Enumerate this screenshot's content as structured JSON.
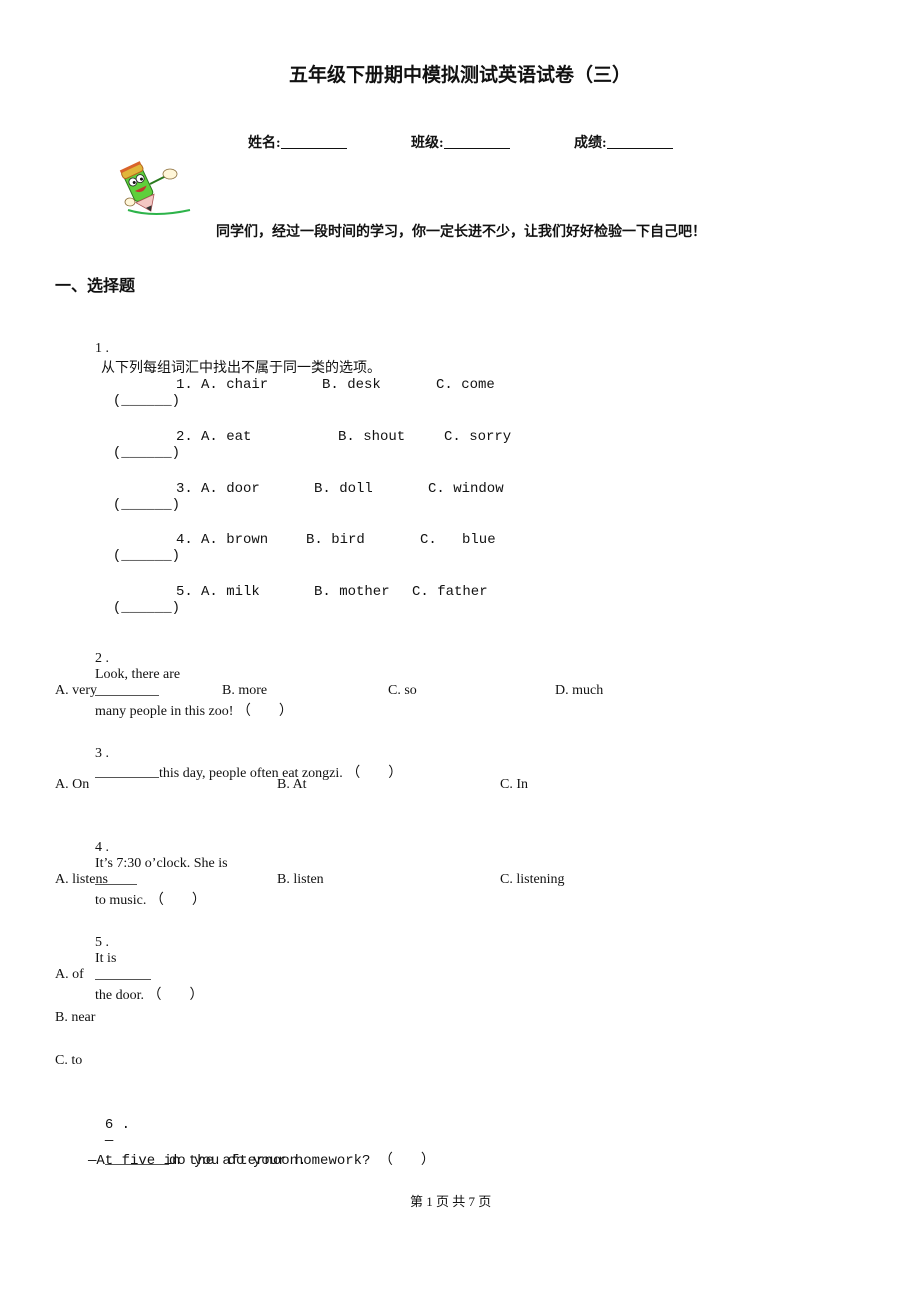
{
  "header": {
    "title": "五年级下册期中模拟测试英语试卷（三）",
    "fields": [
      {
        "label": "姓名:",
        "value": ""
      },
      {
        "label": "班级:",
        "value": ""
      },
      {
        "label": "成绩:",
        "value": ""
      }
    ],
    "mascot_icon": "pencil-mascot-icon",
    "greeting": "同学们，经过一段时间的学习，你一定长进不少，让我们好好检验一下自己吧！"
  },
  "section": {
    "title": "一、选择题"
  },
  "q1": {
    "number": "1 .",
    "prompt": "从下列每组词汇中找出不属于同一类的选项。",
    "items": [
      {
        "paren": "(______)",
        "num": "1.",
        "a": "A. chair",
        "b": "B. desk",
        "c": "C. come"
      },
      {
        "paren": "(______)",
        "num": "2.",
        "a": "A. eat",
        "b": "B. shout",
        "c": "C. sorry"
      },
      {
        "paren": "(______)",
        "num": "3.",
        "a": "A. door",
        "b": "B. doll",
        "c": "C. window"
      },
      {
        "paren": "(______)",
        "num": "4.",
        "a": "A. brown",
        "b": "B. bird",
        "c": "C.   blue"
      },
      {
        "paren": "(______)",
        "num": "5.",
        "a": "A. milk",
        "b": "B. mother",
        "c": "C. father"
      }
    ]
  },
  "q2": {
    "number": "2 .",
    "before": "Look, there are",
    "after": "many people in this zoo! （　　）",
    "options": [
      "A. very",
      "B. more",
      "C. so",
      "D. much"
    ]
  },
  "q3": {
    "number": "3 .",
    "after": "this day, people often eat zongzi. （　　）",
    "options": [
      "A. On",
      "B. At",
      "C. In"
    ]
  },
  "q4": {
    "number": "4 .",
    "before": "It’s 7:30 o’clock. She is",
    "after": "to music. （　　）",
    "options": [
      "A. listens",
      "B. listen",
      "C. listening"
    ]
  },
  "q5": {
    "number": "5 .",
    "before": "It is",
    "after": "the door. （　　）",
    "options": [
      "A. of",
      "B. near",
      "C. to"
    ]
  },
  "q6": {
    "number": "6 .",
    "before": "—",
    "after": "do you do your homework? （　　）",
    "answer_line": "—At five in the afternoon."
  },
  "footer": {
    "page_text": "第 1 页 共 7 页"
  }
}
